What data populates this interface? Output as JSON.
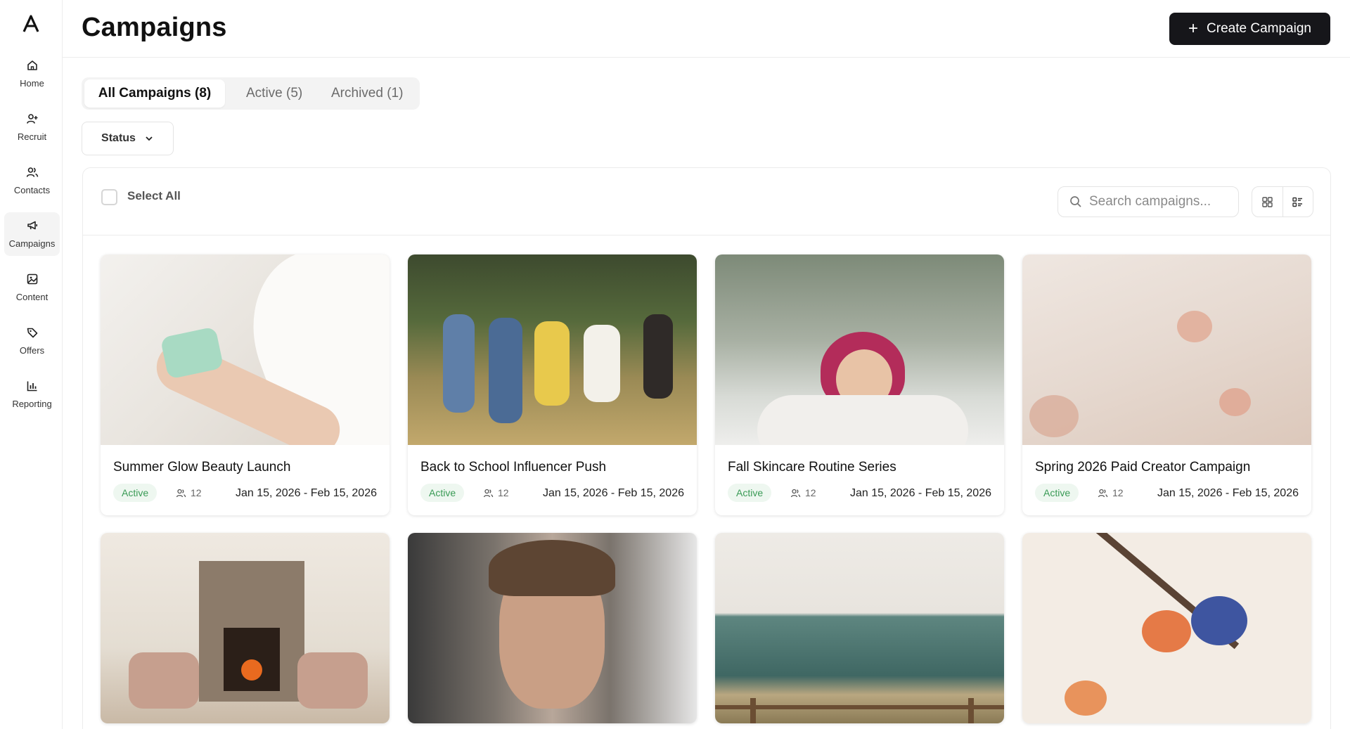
{
  "sidebar": {
    "logo_label": "Λ",
    "items": [
      {
        "label": "Home",
        "icon": "home-icon"
      },
      {
        "label": "Recruit",
        "icon": "user-plus-icon"
      },
      {
        "label": "Contacts",
        "icon": "users-icon"
      },
      {
        "label": "Campaigns",
        "icon": "megaphone-icon"
      },
      {
        "label": "Content",
        "icon": "image-icon"
      },
      {
        "label": "Offers",
        "icon": "tag-icon"
      },
      {
        "label": "Reporting",
        "icon": "bar-chart-icon"
      }
    ],
    "active_item": "Campaigns"
  },
  "header": {
    "title": "Campaigns",
    "create_button": "Create Campaign"
  },
  "tabs": [
    {
      "label": "All Campaigns (8)",
      "selected": true
    },
    {
      "label": "Active (5)",
      "selected": false
    },
    {
      "label": "Archived (1)",
      "selected": false
    }
  ],
  "filters": {
    "status_label": "Status"
  },
  "toolbar": {
    "select_all_label": "Select All",
    "search_placeholder": "Search campaigns..."
  },
  "colors": {
    "primary": "#16161a",
    "active_badge_bg": "#eef7f0",
    "active_badge_text": "#3a9b56"
  },
  "campaigns": [
    {
      "title": "Summer Glow Beauty Launch",
      "status": "Active",
      "members": "12",
      "dates": "Jan 15, 2026 - Feb 15, 2026",
      "image": "hand holding green skincare jar"
    },
    {
      "title": "Back to School Influencer Push",
      "status": "Active",
      "members": "12",
      "dates": "Jan 15, 2026 - Feb 15, 2026",
      "image": "children running in a field"
    },
    {
      "title": "Fall Skincare Routine Series",
      "status": "Active",
      "members": "12",
      "dates": "Jan 15, 2026 - Feb 15, 2026",
      "image": "woman in snow under pine tree"
    },
    {
      "title": "Spring 2026 Paid Creator Campaign",
      "status": "Active",
      "members": "12",
      "dates": "Jan 15, 2026 - Feb 15, 2026",
      "image": "soft pink blossoms"
    },
    {
      "image": "living room with fireplace"
    },
    {
      "image": "woman with closed eyes"
    },
    {
      "image": "sea view with wooden fence"
    },
    {
      "image": "botanical flower illustration"
    }
  ]
}
